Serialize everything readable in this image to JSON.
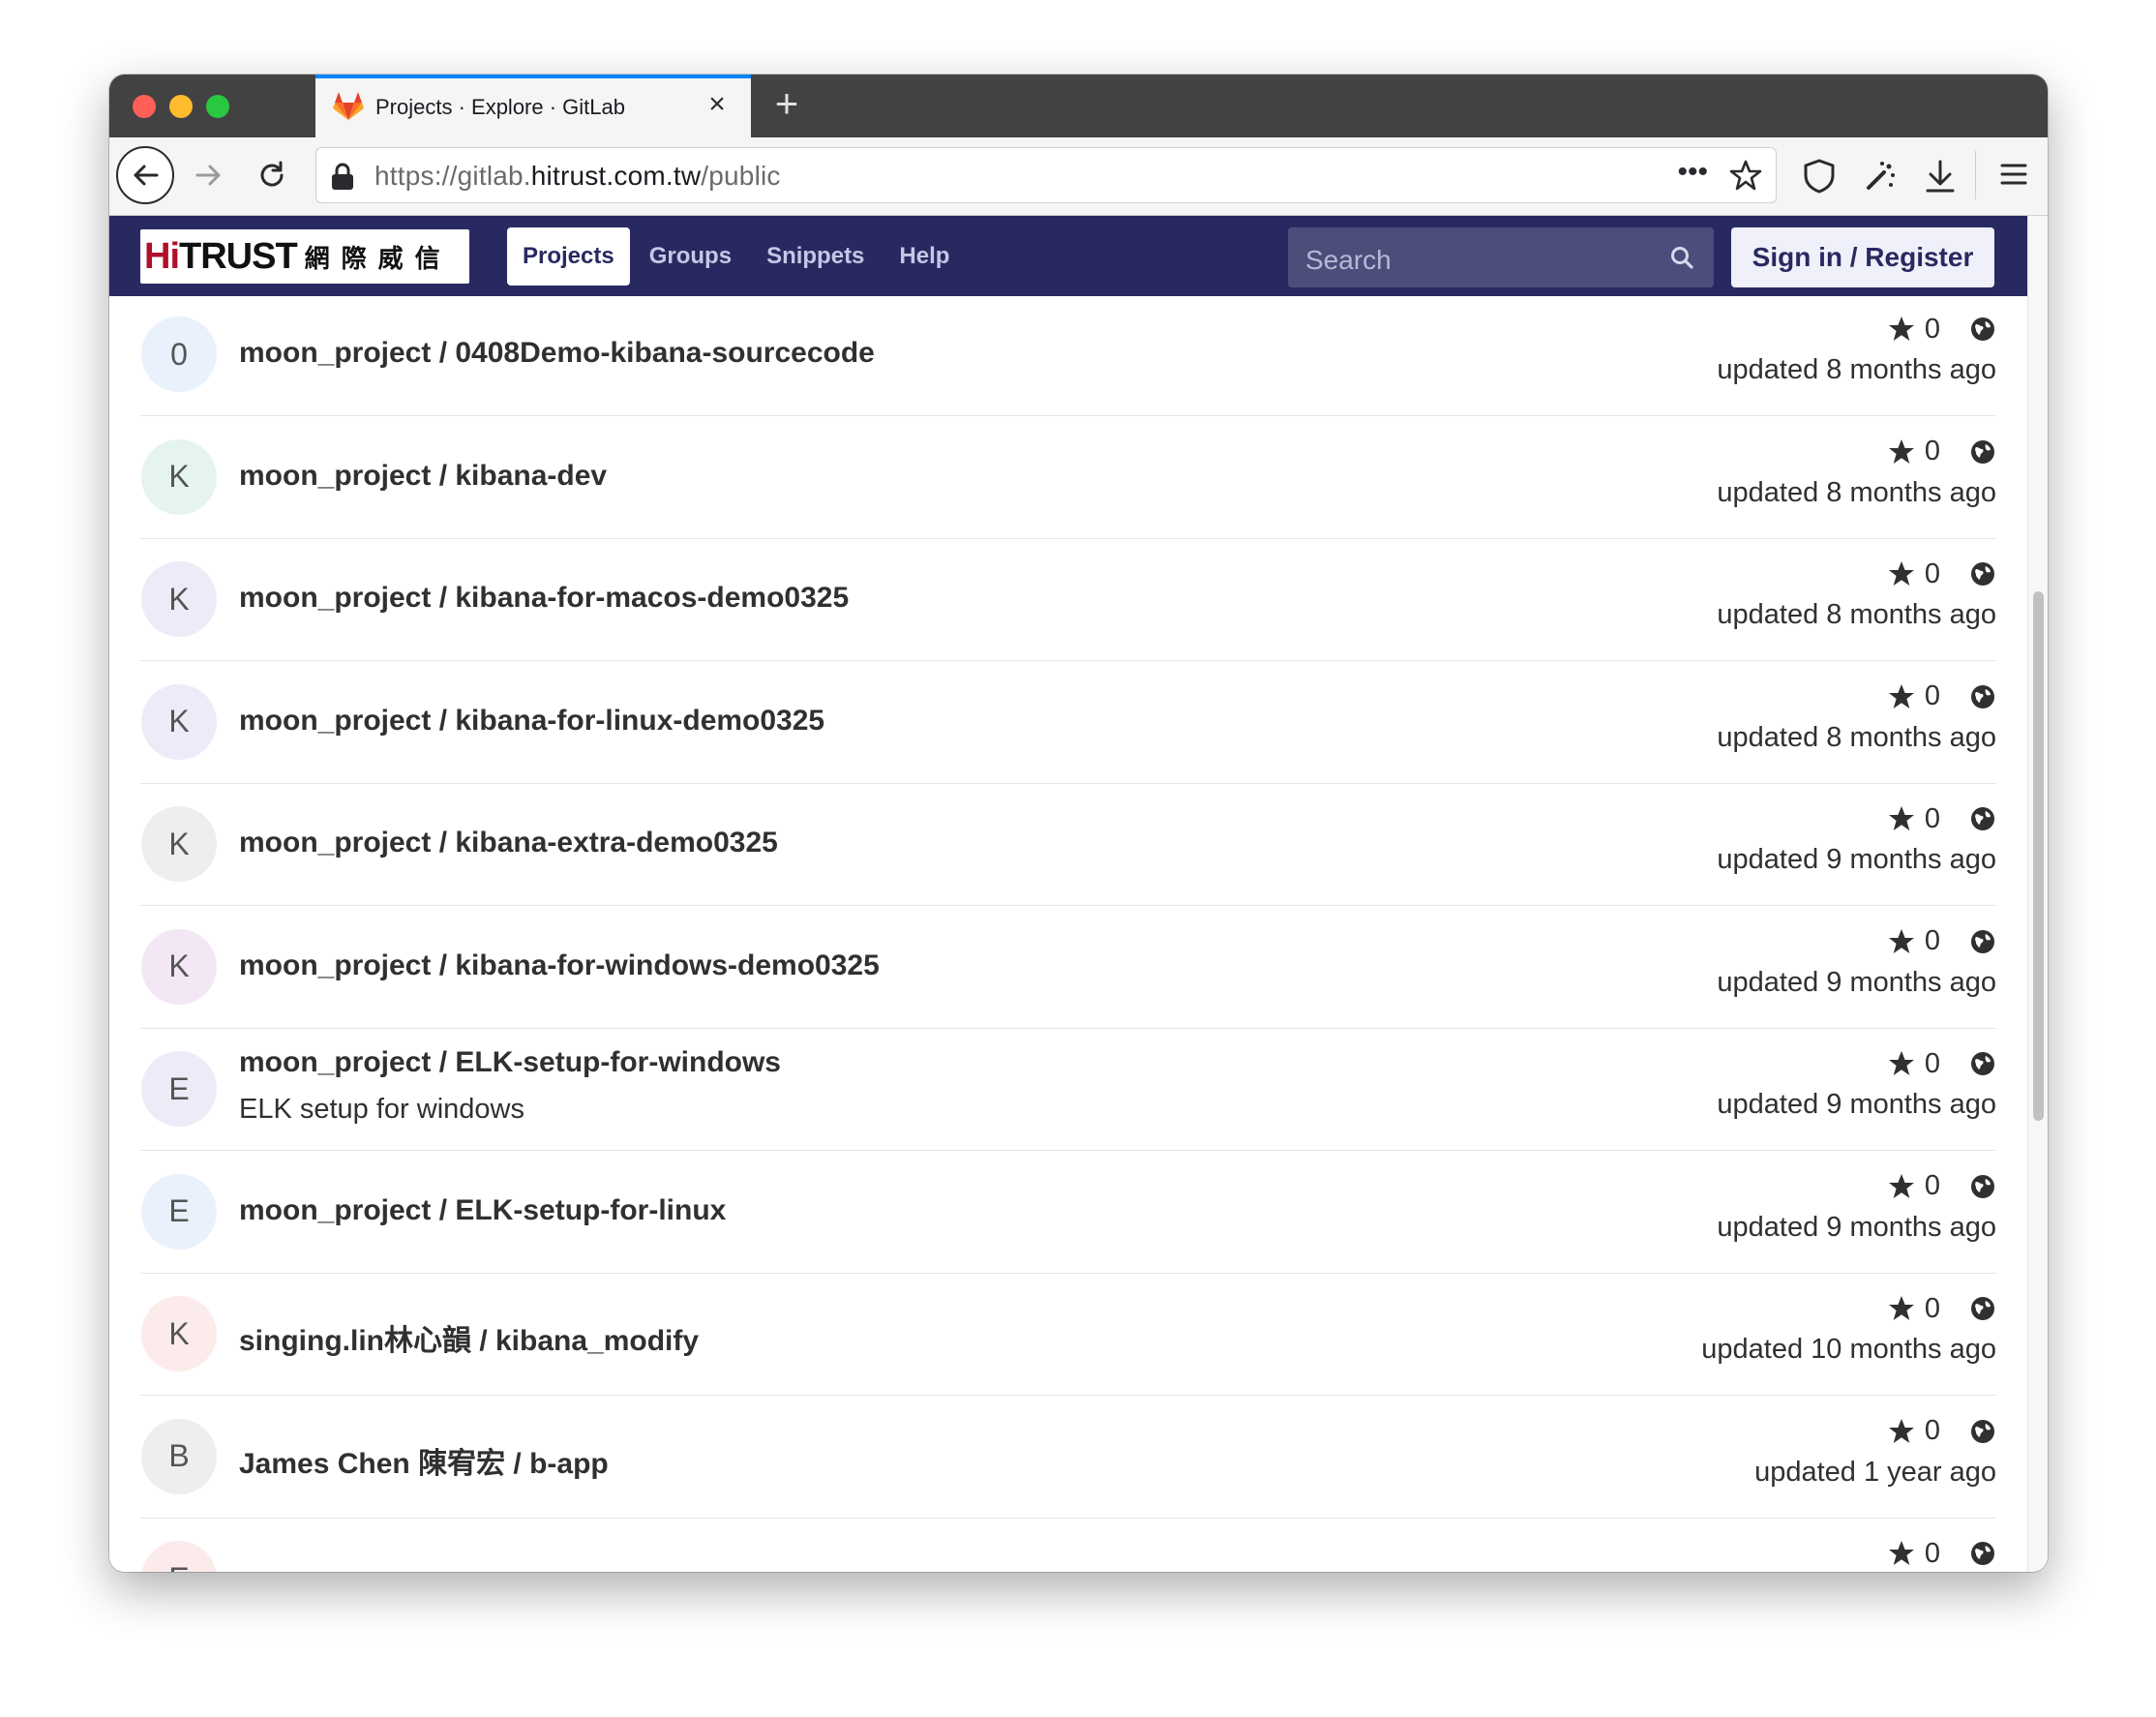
{
  "browser": {
    "tab_title": "Projects · Explore · GitLab",
    "tab_close": "×",
    "new_tab": "+",
    "url_prefix": "https://gitlab.",
    "url_host": "hitrust.com.tw",
    "url_path": "/public",
    "url_more": "•••"
  },
  "gitlab": {
    "logo_text_accent": "Hi",
    "logo_text_rest": "TRUST",
    "logo_cjk": "網際威信",
    "nav": [
      "Projects",
      "Groups",
      "Snippets",
      "Help"
    ],
    "search_placeholder": "Search",
    "signin_label": "Sign in / Register"
  },
  "projects": [
    {
      "avatar": "0",
      "avatar_bg": "#e8f1fc",
      "title": "moon_project / 0408Demo-kibana-sourcecode",
      "description": "",
      "stars": "0",
      "updated": "updated 8 months ago"
    },
    {
      "avatar": "K",
      "avatar_bg": "#e6f4f1",
      "title": "moon_project / kibana-dev",
      "description": "",
      "stars": "0",
      "updated": "updated 8 months ago"
    },
    {
      "avatar": "K",
      "avatar_bg": "#ebecf7",
      "title": "moon_project / kibana-for-macos-demo0325",
      "description": "",
      "stars": "0",
      "updated": "updated 8 months ago"
    },
    {
      "avatar": "K",
      "avatar_bg": "#ebecf7",
      "title": "moon_project / kibana-for-linux-demo0325",
      "description": "",
      "stars": "0",
      "updated": "updated 8 months ago"
    },
    {
      "avatar": "K",
      "avatar_bg": "#eeeeee",
      "title": "moon_project / kibana-extra-demo0325",
      "description": "",
      "stars": "0",
      "updated": "updated 9 months ago"
    },
    {
      "avatar": "K",
      "avatar_bg": "#f3e7f6",
      "title": "moon_project / kibana-for-windows-demo0325",
      "description": "",
      "stars": "0",
      "updated": "updated 9 months ago"
    },
    {
      "avatar": "E",
      "avatar_bg": "#ebecf7",
      "title": "moon_project / ELK-setup-for-windows",
      "description": "ELK setup for windows",
      "stars": "0",
      "updated": "updated 9 months ago"
    },
    {
      "avatar": "E",
      "avatar_bg": "#e8f1fc",
      "title": "moon_project / ELK-setup-for-linux",
      "description": "",
      "stars": "0",
      "updated": "updated 9 months ago"
    },
    {
      "avatar": "K",
      "avatar_bg": "#fcebeb",
      "title": "singing.lin林心韻 / kibana_modify",
      "description": "",
      "stars": "0",
      "updated": "updated 10 months ago"
    },
    {
      "avatar": "B",
      "avatar_bg": "#eeeeee",
      "title": "James Chen 陳宥宏 / b-app",
      "description": "",
      "stars": "0",
      "updated": "updated 1 year ago"
    },
    {
      "avatar": "E",
      "avatar_bg": "#fcebeb",
      "title": "",
      "description": "",
      "stars": "0",
      "updated": ""
    }
  ]
}
